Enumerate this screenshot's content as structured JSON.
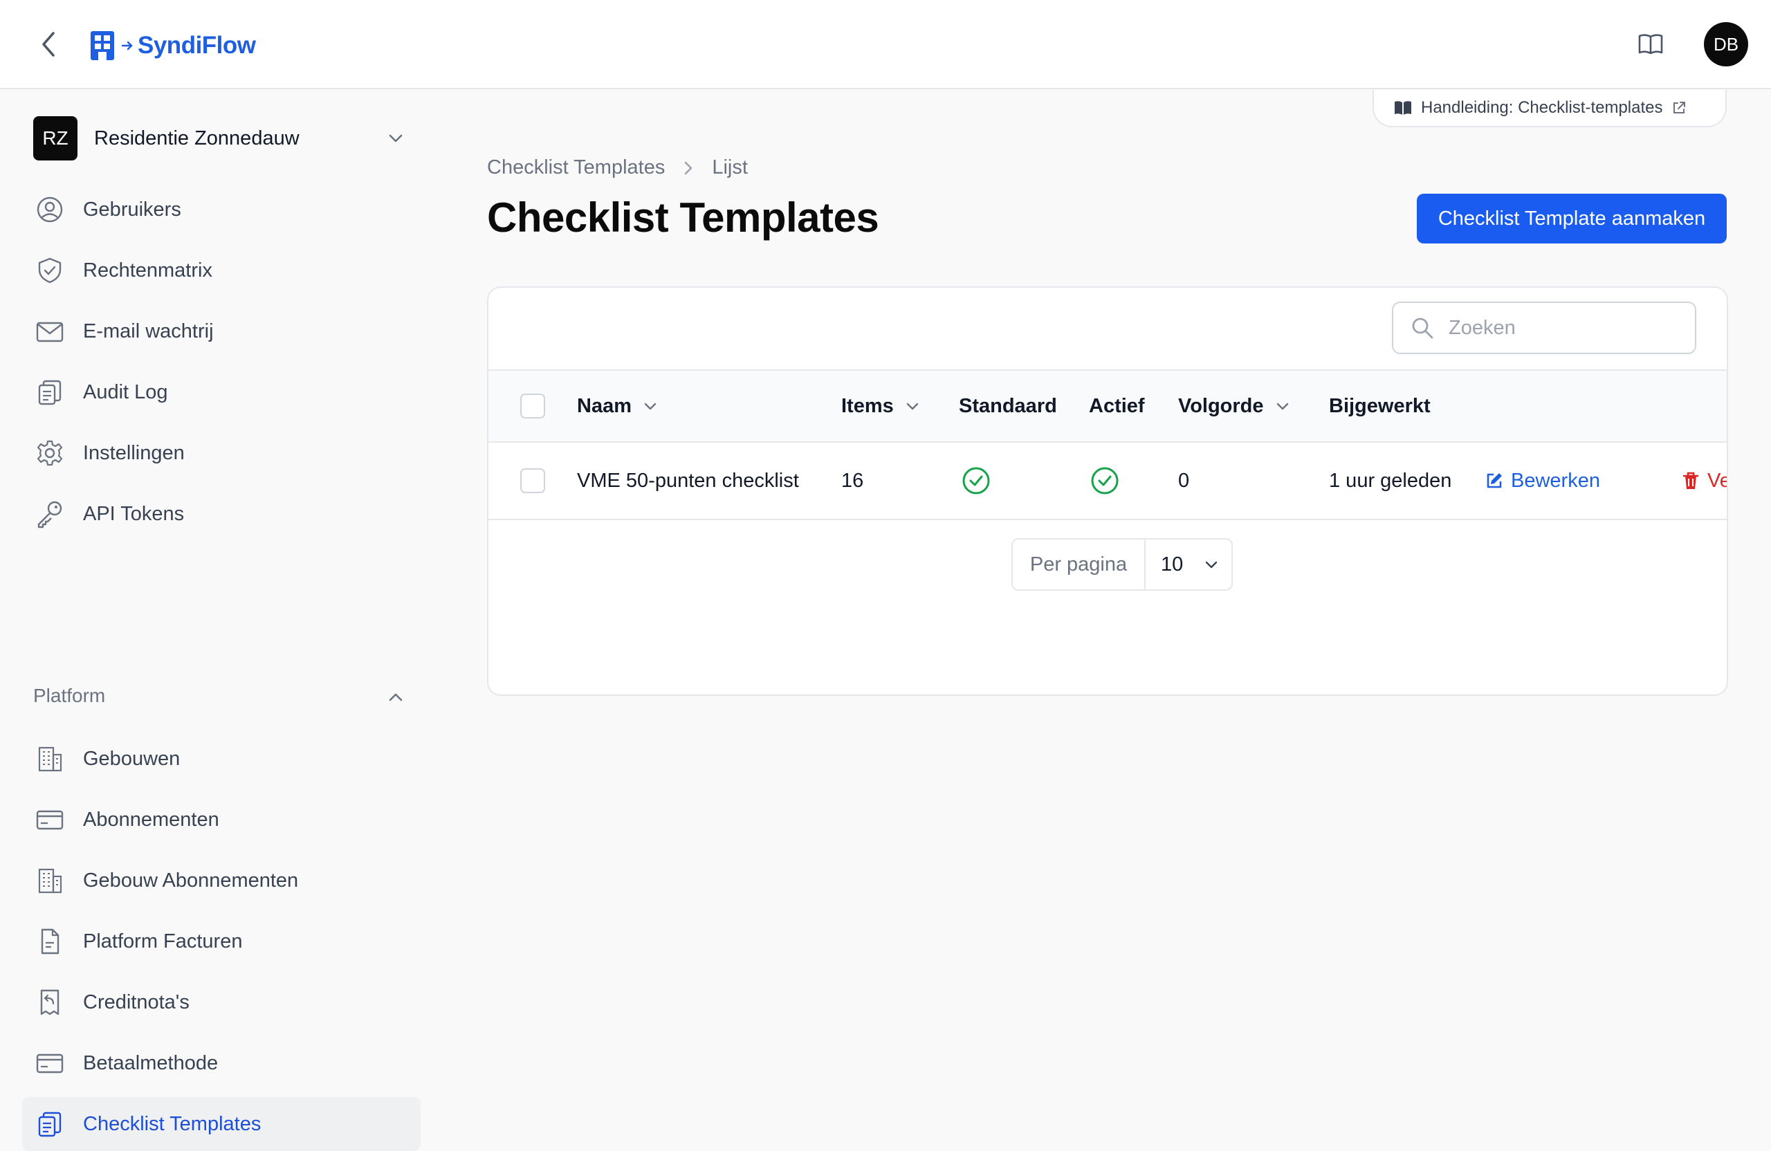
{
  "app": {
    "brand": "SyndiFlow",
    "user_initials": "DB",
    "accent": "#1a5cf0"
  },
  "sidebar": {
    "tenant_initials": "RZ",
    "tenant_name": "Residentie Zonnedauw",
    "items": [
      {
        "label": "Gebruikers",
        "icon": "user-circle-icon"
      },
      {
        "label": "Rechtenmatrix",
        "icon": "shield-check-icon"
      },
      {
        "label": "E-mail wachtrij",
        "icon": "envelope-icon"
      },
      {
        "label": "Audit Log",
        "icon": "clipboard-list-icon"
      },
      {
        "label": "Instellingen",
        "icon": "gear-icon"
      },
      {
        "label": "API Tokens",
        "icon": "key-icon"
      }
    ],
    "group_label": "Platform",
    "platform_items": [
      {
        "label": "Gebouwen",
        "icon": "building-icon"
      },
      {
        "label": "Abonnementen",
        "icon": "credit-card-icon"
      },
      {
        "label": "Gebouw Abonnementen",
        "icon": "building-icon"
      },
      {
        "label": "Platform Facturen",
        "icon": "document-icon"
      },
      {
        "label": "Creditnota's",
        "icon": "receipt-refund-icon"
      },
      {
        "label": "Betaalmethode",
        "icon": "credit-card-icon"
      },
      {
        "label": "Checklist Templates",
        "icon": "clipboard-list-icon",
        "active": true
      }
    ]
  },
  "main": {
    "manual_link": "Handleiding: Checklist-templates",
    "breadcrumb": [
      "Checklist Templates",
      "Lijst"
    ],
    "title": "Checklist Templates",
    "create_button": "Checklist Template aanmaken",
    "search_placeholder": "Zoeken",
    "columns": [
      "Naam",
      "Items",
      "Standaard",
      "Actief",
      "Volgorde",
      "Bijgewerkt"
    ],
    "rows": [
      {
        "naam": "VME 50-punten checklist",
        "items": "16",
        "standaard": true,
        "actief": true,
        "volgorde": "0",
        "bijgewerkt": "1 uur geleden",
        "edit_label": "Bewerken",
        "delete_label": "Verwijde"
      }
    ],
    "pagination": {
      "label": "Per pagina",
      "value": "10"
    }
  }
}
